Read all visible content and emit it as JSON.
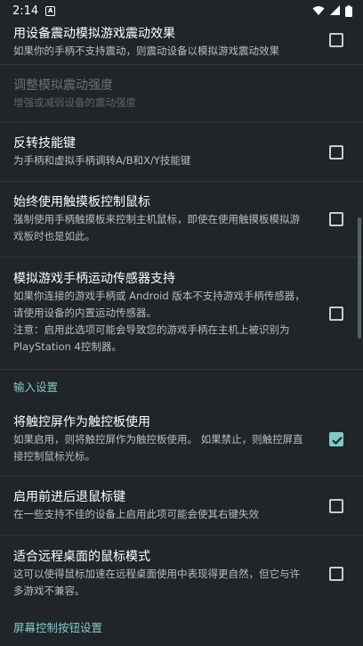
{
  "status_bar": {
    "time": "2:14",
    "notification_icon": "A"
  },
  "settings": [
    {
      "title": "用设备震动模拟游戏震动效果",
      "summary": "如果你的手柄不支持震动，则震动设备以模拟游戏震动效果",
      "checked": false,
      "disabled": false
    },
    {
      "title": "调整模拟震动强度",
      "summary": "增强或减弱设备的震动强度",
      "disabled": true
    },
    {
      "title": "反转技能键",
      "summary": "为手柄和虚拟手柄调转A/B和X/Y技能键",
      "checked": false,
      "disabled": false
    },
    {
      "title": "始终使用触摸板控制鼠标",
      "summary": "强制使用手柄触摸板来控制主机鼠标，即使在使用触摸板模拟游戏板时也是如此。",
      "checked": false,
      "disabled": false
    },
    {
      "title": "模拟游戏手柄运动传感器支持",
      "summary": "如果你连接的游戏手柄或 Android 版本不支持游戏手柄传感器，请使用设备的内置运动传感器。\n注意：启用此选项可能会导致您的游戏手柄在主机上被识别为 PlayStation 4控制器。",
      "checked": false,
      "disabled": false
    }
  ],
  "input_category": "输入设置",
  "input_settings": [
    {
      "title": "将触控屏作为触控板使用",
      "summary": "如果启用，则将触控屏作为触控板使用。 如果禁止，则触控屏直接控制鼠标光标。",
      "checked": true
    },
    {
      "title": "启用前进后退鼠标键",
      "summary": "在一些支持不佳的设备上启用此项可能会使其右键失效",
      "checked": false
    },
    {
      "title": "适合远程桌面的鼠标模式",
      "summary": "这可以使得鼠标加速在远程桌面使用中表现得更自然，但它与许多游戏不兼容。",
      "checked": false
    }
  ],
  "screen_category": "屏幕控制按钮设置",
  "colors": {
    "background": "#1f2529",
    "accent": "#80cbc4",
    "divider": "#2f373c"
  }
}
